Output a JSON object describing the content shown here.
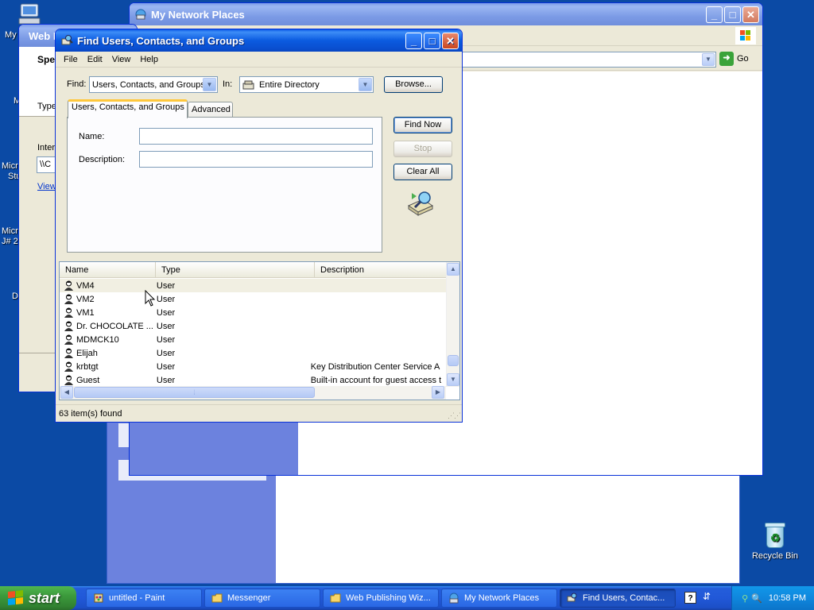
{
  "desktop": {
    "fragments": [
      "My",
      "M",
      "Micro",
      "Stu",
      "Micro",
      "J# 2",
      "D"
    ],
    "recycle_bin": "Recycle Bin"
  },
  "wizard_window": {
    "title": "Web P",
    "heading": "Spe",
    "type_label": "Type",
    "internet_label": "Inter",
    "path_field": "\\\\C",
    "view_link": "View"
  },
  "network_window": {
    "title": "My Network Places",
    "go_label": "Go"
  },
  "find_dialog": {
    "title": "Find Users, Contacts, and Groups",
    "menu": [
      "File",
      "Edit",
      "View",
      "Help"
    ],
    "find_label": "Find:",
    "find_value": "Users, Contacts, and Groups",
    "in_label": "In:",
    "in_value": "Entire Directory",
    "browse_button": "Browse...",
    "tabs": [
      "Users, Contacts, and Groups",
      "Advanced"
    ],
    "name_label": "Name:",
    "name_value": "",
    "description_label": "Description:",
    "description_value": "",
    "find_now_button": "Find Now",
    "stop_button": "Stop",
    "clear_all_button": "Clear All",
    "columns": [
      "Name",
      "Type",
      "Description"
    ],
    "rows": [
      {
        "name": "VM4",
        "type": "User",
        "description": ""
      },
      {
        "name": "VM2",
        "type": "User",
        "description": ""
      },
      {
        "name": "VM1",
        "type": "User",
        "description": ""
      },
      {
        "name": "Dr. CHOCOLATE ...",
        "type": "User",
        "description": ""
      },
      {
        "name": "MDMCK10",
        "type": "User",
        "description": ""
      },
      {
        "name": "Elijah",
        "type": "User",
        "description": ""
      },
      {
        "name": "krbtgt",
        "type": "User",
        "description": "Key Distribution Center Service A"
      },
      {
        "name": "Guest",
        "type": "User",
        "description": "Built-in account for guest access t"
      }
    ],
    "status": "63 item(s) found"
  },
  "taskbar": {
    "start_label": "start",
    "tasks": [
      {
        "label": "untitled - Paint",
        "icon": "paint-icon"
      },
      {
        "label": "Messenger",
        "icon": "folder-icon"
      },
      {
        "label": "Web Publishing Wiz...",
        "icon": "folder-icon"
      },
      {
        "label": "My Network Places",
        "icon": "network-places-icon"
      },
      {
        "label": "Find Users, Contac...",
        "icon": "find-users-icon"
      }
    ],
    "clock": "10:58 PM"
  },
  "colors": {
    "desktop_bg": "#0b4aa5",
    "title_active": "#0b5be0",
    "dialog_bg": "#ece9d8"
  }
}
